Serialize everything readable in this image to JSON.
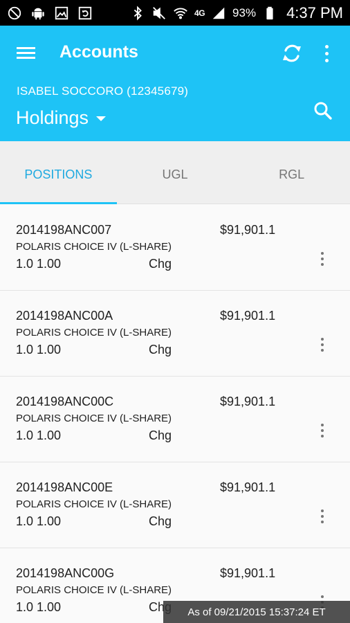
{
  "status_bar": {
    "network": "4G",
    "battery_pct": "93%",
    "time": "4:37 PM",
    "icons": [
      "block-icon",
      "android-icon",
      "image-icon",
      "screenshot-icon",
      "bluetooth-icon",
      "mute-icon",
      "wifi-icon",
      "signal-icon",
      "battery-icon"
    ]
  },
  "header": {
    "title": "Accounts",
    "account": "ISABEL SOCCORO (12345679)",
    "view": "Holdings",
    "accent_color": "#1ec3f6"
  },
  "tabs": [
    {
      "label": "POSITIONS",
      "active": true
    },
    {
      "label": "UGL",
      "active": false
    },
    {
      "label": "RGL",
      "active": false
    }
  ],
  "positions": [
    {
      "symbol": "2014198ANC007",
      "value": "$91,901.1",
      "description": "POLARIS CHOICE IV (L-SHARE)",
      "qty": "1.0 1.00",
      "chg": "Chg"
    },
    {
      "symbol": "2014198ANC00A",
      "value": "$91,901.1",
      "description": "POLARIS CHOICE IV (L-SHARE)",
      "qty": "1.0 1.00",
      "chg": "Chg"
    },
    {
      "symbol": "2014198ANC00C",
      "value": "$91,901.1",
      "description": "POLARIS CHOICE IV (L-SHARE)",
      "qty": "1.0 1.00",
      "chg": "Chg"
    },
    {
      "symbol": "2014198ANC00E",
      "value": "$91,901.1",
      "description": "POLARIS CHOICE IV (L-SHARE)",
      "qty": "1.0 1.00",
      "chg": "Chg"
    },
    {
      "symbol": "2014198ANC00G",
      "value": "$91,901.1",
      "description": "POLARIS CHOICE IV (L-SHARE)",
      "qty": "1.0 1.00",
      "chg": "Chg"
    }
  ],
  "footer": {
    "as_of": "As of 09/21/2015 15:37:24 ET"
  }
}
